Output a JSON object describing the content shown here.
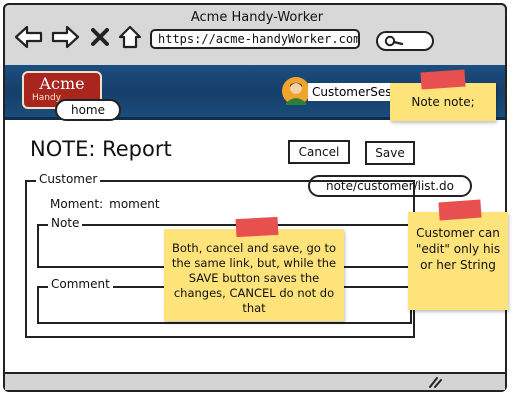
{
  "window": {
    "title": "Acme Handy-Worker"
  },
  "browser": {
    "url": "https://acme-handyWorker.com/"
  },
  "header": {
    "logo_text": "Acme",
    "logo_subtext": "Handy",
    "username": "CustomerSession",
    "colors": {
      "banner": "#1b4e80",
      "logo": "#a9261f",
      "sticky_note": "#fde37a",
      "tape": "#e85050"
    }
  },
  "annotations": {
    "home_link": "home",
    "cancel_link": "note/customer/list.do",
    "note_top": "Note note;",
    "note_buttons": "Both, cancel and save, go to the same link, but, while the SAVE button saves the changes, CANCEL do not do that",
    "note_customer": "Customer can \"edit\" only his or her String"
  },
  "page": {
    "title": "NOTE: Report",
    "cancel_label": "Cancel",
    "save_label": "Save"
  },
  "form": {
    "customer_legend": "Customer",
    "moment_label": "Moment:",
    "moment_value": "moment",
    "note_legend": "Note",
    "comment_legend": "Comment"
  },
  "icons": [
    "back-arrow-icon",
    "forward-arrow-icon",
    "close-icon",
    "home-icon",
    "search-icon",
    "user-avatar-icon",
    "resize-grip-icon"
  ]
}
